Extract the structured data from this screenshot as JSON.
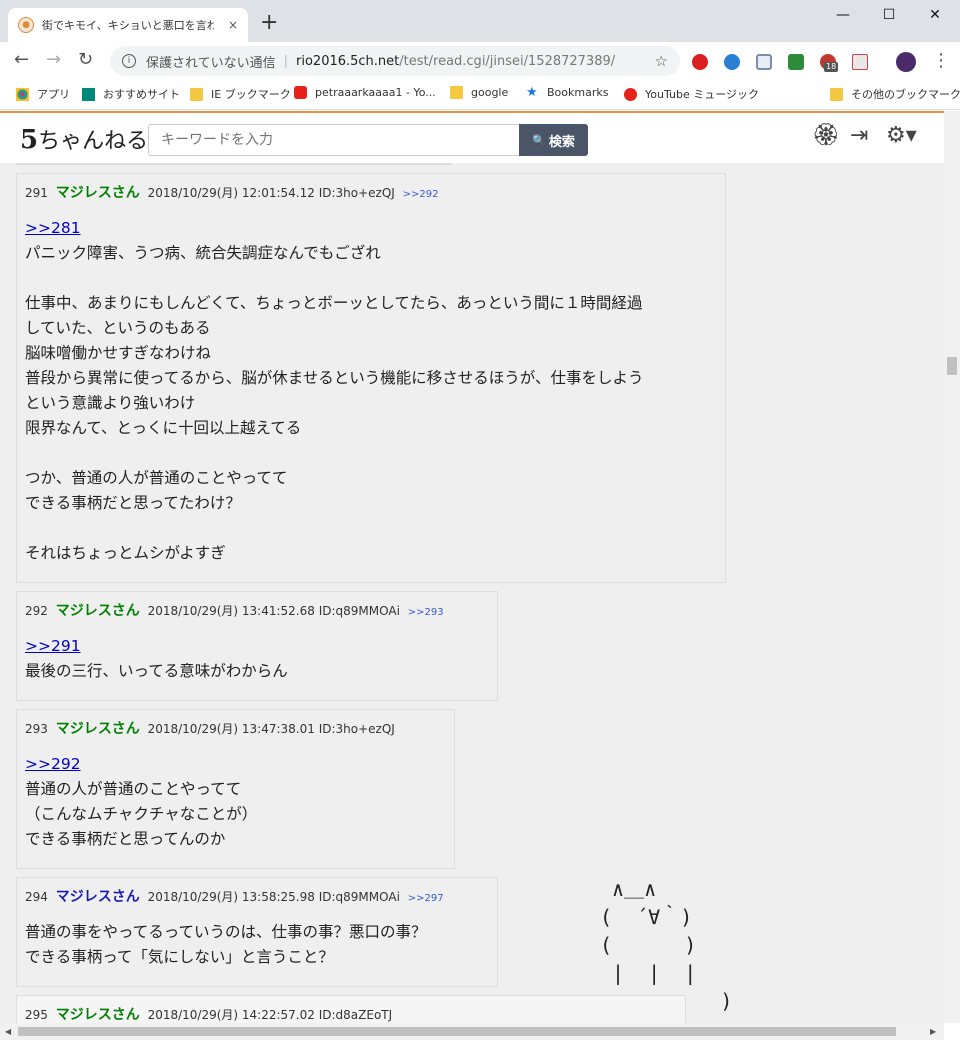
{
  "browser": {
    "tab_title": "街でキモイ、キショいと悪口を言われる",
    "tab_close": "×",
    "new_tab": "+",
    "win_min": "—",
    "win_max": "☐",
    "win_close": "✕",
    "back": "←",
    "forward": "→",
    "reload": "↻",
    "address_secure_text": "保護されていない通信",
    "address_separator": "|",
    "address_host": "rio2016.5ch.net",
    "address_path": "/test/read.cgi/jinsei/1528727389/",
    "star": "☆",
    "ext_badge": "18",
    "menu": "⋮",
    "bookmarks": [
      {
        "label": "アプリ"
      },
      {
        "label": "おすすめサイト"
      },
      {
        "label": "IE ブックマーク"
      },
      {
        "label": "petraaarkaaaa1 - Yo..."
      },
      {
        "label": "google"
      },
      {
        "label": "Bookmarks"
      },
      {
        "label": "YouTube ミュージック"
      },
      {
        "label": "その他のブックマーク"
      }
    ]
  },
  "site": {
    "logo_num": "5",
    "logo_text": "ちゃんねる",
    "search_placeholder": "キーワードを入力",
    "search_button": "検索",
    "search_icon": "🔍",
    "icon_badge": "🏵",
    "icon_login": "⇥",
    "icon_settings": "⚙▾"
  },
  "posts": [
    {
      "num": "291",
      "name": "マジレスさん",
      "datetime": "2018/10/29(月) 12:01:54.12",
      "id": "ID:3ho+ezQJ",
      "reflink": ">>292",
      "anchor": ">>281",
      "body": "パニック障害、うつ病、統合失調症なんでもござれ\n\n仕事中、あまりにもしんどくて、ちょっとボーッとしてたら、あっという間に１時間経過\nしていた、というのもある\n脳味噌働かせすぎなわけね\n普段から異常に使ってるから、脳が休ませるという機能に移させるほうが、仕事をしよう\nという意識より強いわけ\n限界なんて、とっくに十回以上越えてる\n\nつか、普通の人が普通のことやってて\nできる事柄だと思ってたわけ？\n\nそれはちょっとムシがよすぎ"
    },
    {
      "num": "292",
      "name": "マジレスさん",
      "datetime": "2018/10/29(月) 13:41:52.68",
      "id": "ID:q89MMOAi",
      "reflink": ">>293",
      "anchor": ">>291",
      "body": "最後の三行、いってる意味がわからん"
    },
    {
      "num": "293",
      "name": "マジレスさん",
      "datetime": "2018/10/29(月) 13:47:38.01",
      "id": "ID:3ho+ezQJ",
      "reflink": "",
      "anchor": ">>292",
      "body": "普通の人が普通のことやってて\n（こんなムチャクチャなことが）\nできる事柄だと思ってんのか"
    },
    {
      "num": "294",
      "name": "マジレスさん",
      "datetime": "2018/10/29(月) 13:58:25.98",
      "id": "ID:q89MMOAi",
      "reflink": ">>297",
      "anchor": "",
      "body": "普通の事をやってるっていうのは、仕事の事？悪口の事？\nできる事柄って「気にしない」と言うこと？"
    },
    {
      "num": "295",
      "name": "マジレスさん",
      "datetime": "2018/10/29(月) 14:22:57.02",
      "id": "ID:d8aZEoTJ",
      "reflink": "",
      "anchor": "",
      "body": ""
    }
  ],
  "ascii_art": " ∧＿∧\n(  ´∀｀)\n(      )\n |  |  |\n          )"
}
